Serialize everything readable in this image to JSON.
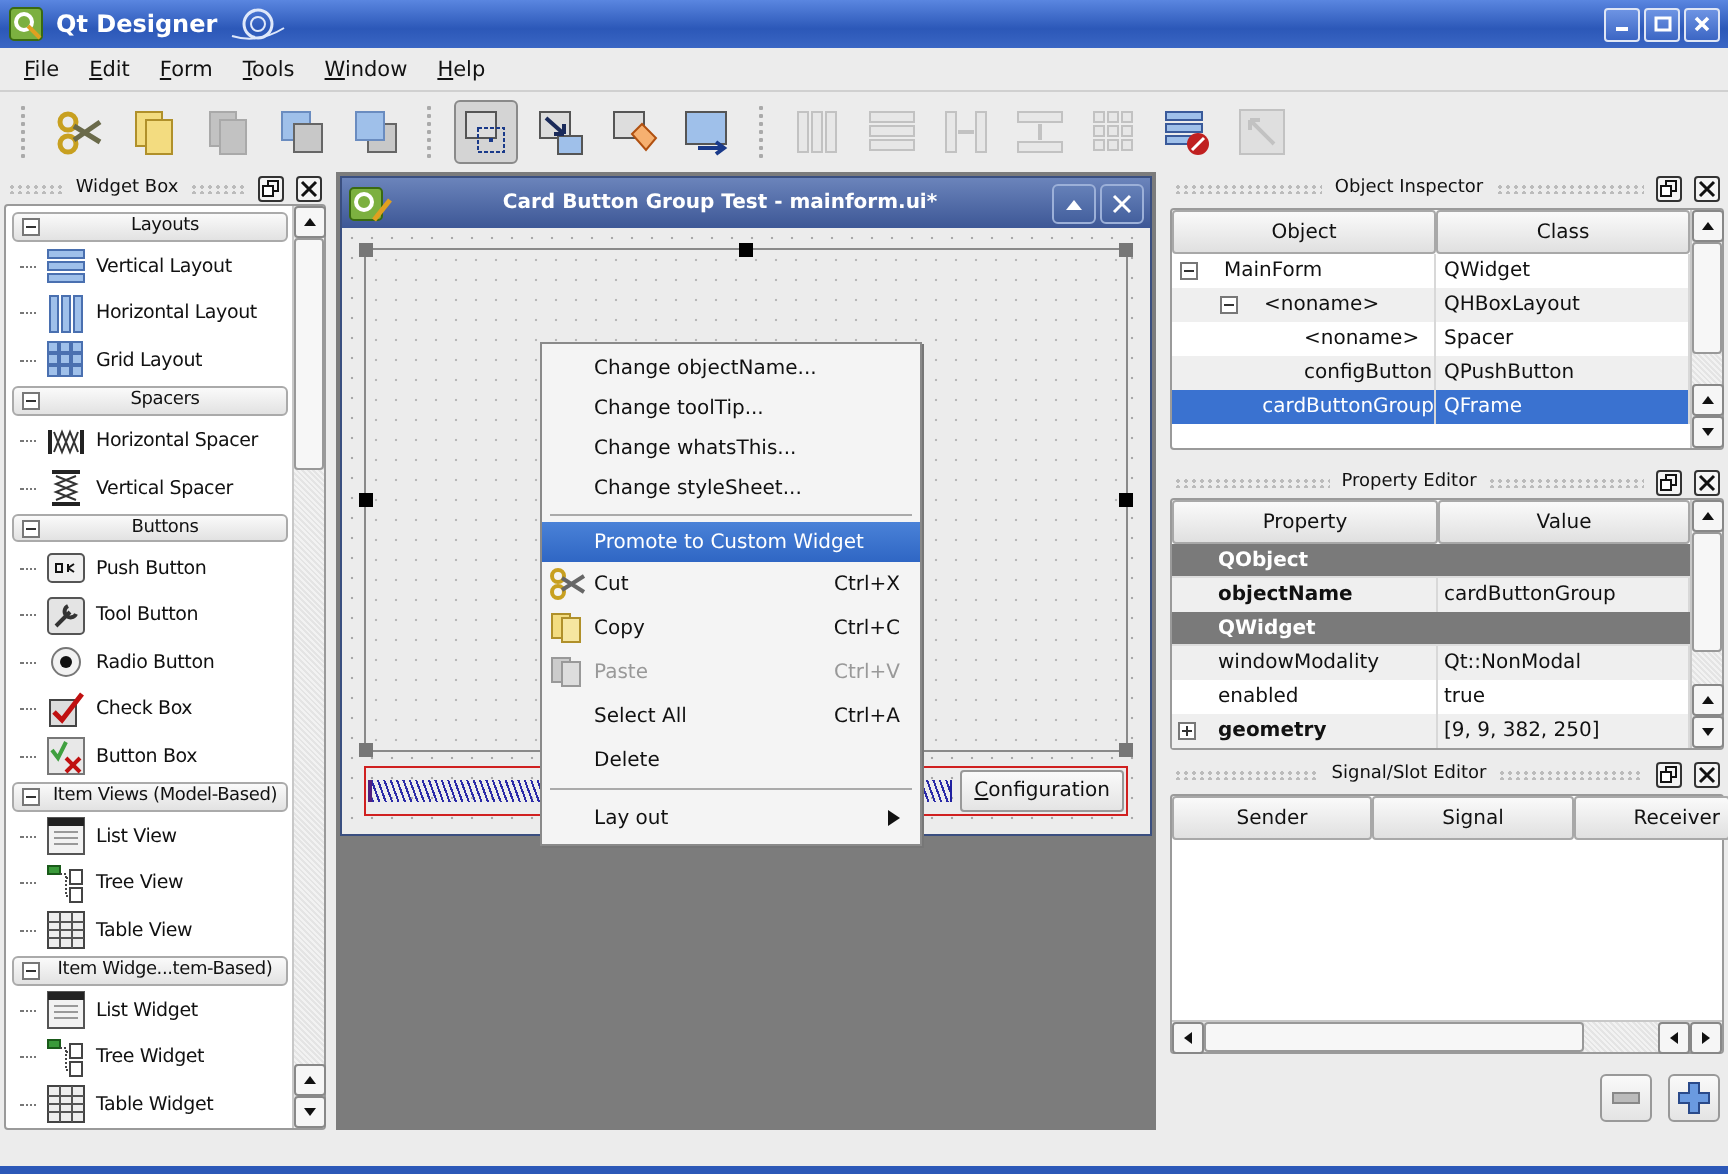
{
  "window": {
    "title": "Qt Designer"
  },
  "menu_bar": [
    "File",
    "Edit",
    "Form",
    "Tools",
    "Window",
    "Help"
  ],
  "toolbar": [
    {
      "kind": "cut",
      "selected": false,
      "disabled": false
    },
    {
      "kind": "copy",
      "selected": false,
      "disabled": false
    },
    {
      "kind": "paste",
      "selected": false,
      "disabled": true
    },
    {
      "kind": "send_back",
      "selected": false,
      "disabled": false
    },
    {
      "kind": "bring_front",
      "selected": false,
      "disabled": false
    },
    {
      "kind": "separator"
    },
    {
      "kind": "edit_widgets",
      "selected": true,
      "disabled": false
    },
    {
      "kind": "edit_signals",
      "selected": false,
      "disabled": false
    },
    {
      "kind": "edit_buddies",
      "selected": false,
      "disabled": false
    },
    {
      "kind": "edit_taborder",
      "selected": false,
      "disabled": false
    },
    {
      "kind": "separator"
    },
    {
      "kind": "layout_h",
      "selected": false,
      "disabled": true
    },
    {
      "kind": "layout_v",
      "selected": false,
      "disabled": true
    },
    {
      "kind": "split_h",
      "selected": false,
      "disabled": true
    },
    {
      "kind": "split_v",
      "selected": false,
      "disabled": true
    },
    {
      "kind": "layout_grid",
      "selected": false,
      "disabled": true
    },
    {
      "kind": "break_layout",
      "selected": false,
      "disabled": false
    },
    {
      "kind": "adjust_size",
      "selected": false,
      "disabled": true
    }
  ],
  "widget_box": {
    "title": "Widget Box",
    "categories": [
      {
        "label": "Layouts",
        "expanded": true,
        "items": [
          {
            "label": "Vertical Layout",
            "kind": "vlayout"
          },
          {
            "label": "Horizontal Layout",
            "kind": "hlayout"
          },
          {
            "label": "Grid Layout",
            "kind": "grid"
          }
        ]
      },
      {
        "label": "Spacers",
        "expanded": true,
        "items": [
          {
            "label": "Horizontal Spacer",
            "kind": "hspacer"
          },
          {
            "label": "Vertical Spacer",
            "kind": "vspacer"
          }
        ]
      },
      {
        "label": "Buttons",
        "expanded": true,
        "items": [
          {
            "label": "Push Button",
            "kind": "push"
          },
          {
            "label": "Tool Button",
            "kind": "tool"
          },
          {
            "label": "Radio Button",
            "kind": "radio"
          },
          {
            "label": "Check Box",
            "kind": "check"
          },
          {
            "label": "Button Box",
            "kind": "buttonbox"
          }
        ]
      },
      {
        "label": "Item Views (Model-Based)",
        "expanded": true,
        "items": [
          {
            "label": "List View",
            "kind": "list"
          },
          {
            "label": "Tree View",
            "kind": "tree"
          },
          {
            "label": "Table View",
            "kind": "table"
          }
        ]
      },
      {
        "label": "Item Widge...tem-Based)",
        "expanded": true,
        "items": [
          {
            "label": "List Widget",
            "kind": "list"
          },
          {
            "label": "Tree Widget",
            "kind": "tree"
          },
          {
            "label": "Table Widget",
            "kind": "table"
          }
        ]
      }
    ]
  },
  "form_window": {
    "title": "Card Button Group Test - mainform.ui*",
    "button_label": "Configuration",
    "context_menu": [
      {
        "kind": "item",
        "label": "Change objectName...",
        "disabled": false,
        "selected": false
      },
      {
        "kind": "item",
        "label": "Change toolTip...",
        "disabled": false,
        "selected": false
      },
      {
        "kind": "item",
        "label": "Change whatsThis...",
        "disabled": false,
        "selected": false
      },
      {
        "kind": "item",
        "label": "Change styleSheet...",
        "disabled": false,
        "selected": false
      },
      {
        "kind": "separator"
      },
      {
        "kind": "item",
        "label": "Promote to Custom Widget",
        "disabled": false,
        "selected": true
      },
      {
        "kind": "cut",
        "label": "Cut",
        "shortcut": "Ctrl+X",
        "disabled": false,
        "selected": false
      },
      {
        "kind": "copy",
        "label": "Copy",
        "shortcut": "Ctrl+C",
        "disabled": false,
        "selected": false
      },
      {
        "kind": "paste",
        "label": "Paste",
        "shortcut": "Ctrl+V",
        "disabled": true,
        "selected": false
      },
      {
        "kind": "item",
        "label": "Select All",
        "shortcut": "Ctrl+A",
        "disabled": false,
        "selected": false
      },
      {
        "kind": "item",
        "label": "Delete",
        "disabled": false,
        "selected": false
      },
      {
        "kind": "separator"
      },
      {
        "kind": "submenu",
        "label": "Lay out",
        "disabled": false,
        "selected": false
      }
    ]
  },
  "object_inspector": {
    "title": "Object Inspector",
    "columns": [
      "Object",
      "Class"
    ],
    "rows": [
      {
        "object": "MainForm",
        "class": "QWidget",
        "selected": false,
        "expanded": true,
        "children": [
          {
            "object": "<noname>",
            "class": "QHBoxLayout",
            "selected": false,
            "expanded": true,
            "children": [
              {
                "object": "<noname>",
                "class": "Spacer",
                "selected": false
              },
              {
                "object": "configButton",
                "class": "QPushButton",
                "selected": false
              }
            ]
          },
          {
            "object": "cardButtonGroup",
            "class": "QFrame",
            "selected": true
          }
        ]
      }
    ]
  },
  "property_editor": {
    "title": "Property Editor",
    "columns": [
      "Property",
      "Value"
    ],
    "rows": [
      {
        "kind": "group",
        "name": "QObject"
      },
      {
        "kind": "property",
        "name": "objectName",
        "value": "cardButtonGroup",
        "changed": true
      },
      {
        "kind": "group",
        "name": "QWidget"
      },
      {
        "kind": "property",
        "name": "windowModality",
        "value": "Qt::NonModal",
        "changed": false
      },
      {
        "kind": "property",
        "name": "enabled",
        "value": "true",
        "changed": false
      },
      {
        "kind": "property",
        "name": "geometry",
        "value": "[9, 9, 382, 250]",
        "changed": true,
        "expanded": false
      }
    ]
  },
  "signal_slot_editor": {
    "title": "Signal/Slot Editor",
    "columns": [
      "Sender",
      "Signal",
      "Receiver"
    ]
  }
}
